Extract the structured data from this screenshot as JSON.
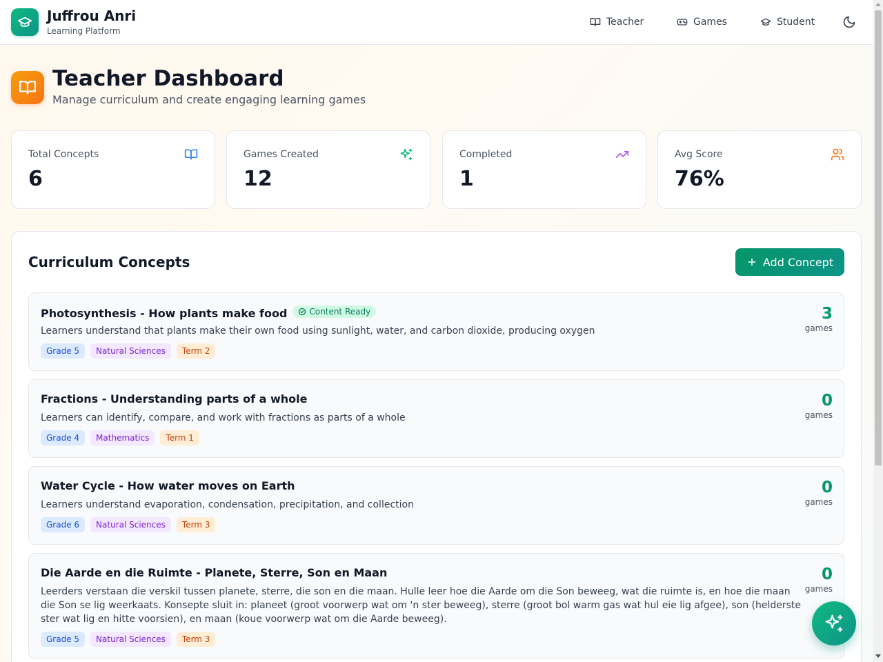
{
  "brand": {
    "title": "Juffrou Anri",
    "subtitle": "Learning Platform"
  },
  "nav": {
    "teacher": "Teacher",
    "games": "Games",
    "student": "Student"
  },
  "header": {
    "title": "Teacher Dashboard",
    "subtitle": "Manage curriculum and create engaging learning games"
  },
  "stats": [
    {
      "label": "Total Concepts",
      "value": "6",
      "icon": "book-icon",
      "color": "#3b82f6"
    },
    {
      "label": "Games Created",
      "value": "12",
      "icon": "sparkles-icon",
      "color": "#10b981"
    },
    {
      "label": "Completed",
      "value": "1",
      "icon": "trending-up-icon",
      "color": "#a855f7"
    },
    {
      "label": "Avg Score",
      "value": "76%",
      "icon": "users-icon",
      "color": "#f97316"
    }
  ],
  "panel": {
    "title": "Curriculum Concepts",
    "add_label": "Add Concept"
  },
  "concepts": [
    {
      "title": "Photosynthesis - How plants make food",
      "badge": "Content Ready",
      "description": "Learners understand that plants make their own food using sunlight, water, and carbon dioxide, producing oxygen",
      "grade": "Grade 5",
      "subject": "Natural Sciences",
      "term": "Term 2",
      "games": "3",
      "games_label": "games"
    },
    {
      "title": "Fractions - Understanding parts of a whole",
      "description": "Learners can identify, compare, and work with fractions as parts of a whole",
      "grade": "Grade 4",
      "subject": "Mathematics",
      "term": "Term 1",
      "games": "0",
      "games_label": "games"
    },
    {
      "title": "Water Cycle - How water moves on Earth",
      "description": "Learners understand evaporation, condensation, precipitation, and collection",
      "grade": "Grade 6",
      "subject": "Natural Sciences",
      "term": "Term 3",
      "games": "0",
      "games_label": "games"
    },
    {
      "title": "Die Aarde en die Ruimte - Planete, Sterre, Son en Maan",
      "description": "Leerders verstaan die verskil tussen planete, sterre, die son en die maan. Hulle leer hoe die Aarde om die Son beweeg, wat die ruimte is, en hoe die maan die Son se lig weerkaats. Konsepte sluit in: planeet (groot voorwerp wat om 'n ster beweeg), sterre (groot bol warm gas wat hul eie lig afgee), son (helderste ster wat lig en hitte voorsien), en maan (koue voorwerp wat om die Aarde beweeg).",
      "grade": "Grade 5",
      "subject": "Natural Sciences",
      "term": "Term 3",
      "games": "0",
      "games_label": "games"
    }
  ]
}
